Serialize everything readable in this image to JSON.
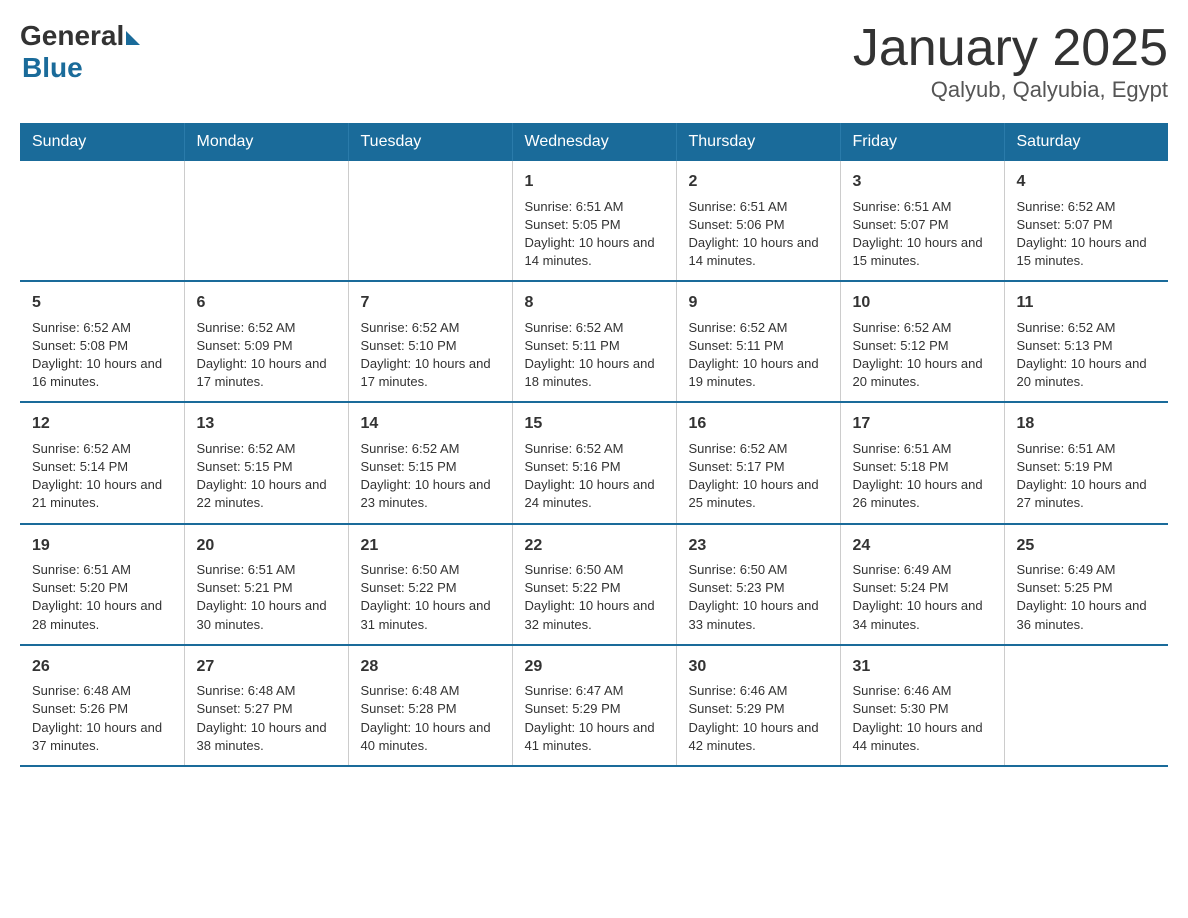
{
  "logo": {
    "general": "General",
    "blue": "Blue"
  },
  "title": "January 2025",
  "subtitle": "Qalyub, Qalyubia, Egypt",
  "days_of_week": [
    "Sunday",
    "Monday",
    "Tuesday",
    "Wednesday",
    "Thursday",
    "Friday",
    "Saturday"
  ],
  "weeks": [
    [
      {
        "day": "",
        "info": ""
      },
      {
        "day": "",
        "info": ""
      },
      {
        "day": "",
        "info": ""
      },
      {
        "day": "1",
        "info": "Sunrise: 6:51 AM\nSunset: 5:05 PM\nDaylight: 10 hours and 14 minutes."
      },
      {
        "day": "2",
        "info": "Sunrise: 6:51 AM\nSunset: 5:06 PM\nDaylight: 10 hours and 14 minutes."
      },
      {
        "day": "3",
        "info": "Sunrise: 6:51 AM\nSunset: 5:07 PM\nDaylight: 10 hours and 15 minutes."
      },
      {
        "day": "4",
        "info": "Sunrise: 6:52 AM\nSunset: 5:07 PM\nDaylight: 10 hours and 15 minutes."
      }
    ],
    [
      {
        "day": "5",
        "info": "Sunrise: 6:52 AM\nSunset: 5:08 PM\nDaylight: 10 hours and 16 minutes."
      },
      {
        "day": "6",
        "info": "Sunrise: 6:52 AM\nSunset: 5:09 PM\nDaylight: 10 hours and 17 minutes."
      },
      {
        "day": "7",
        "info": "Sunrise: 6:52 AM\nSunset: 5:10 PM\nDaylight: 10 hours and 17 minutes."
      },
      {
        "day": "8",
        "info": "Sunrise: 6:52 AM\nSunset: 5:11 PM\nDaylight: 10 hours and 18 minutes."
      },
      {
        "day": "9",
        "info": "Sunrise: 6:52 AM\nSunset: 5:11 PM\nDaylight: 10 hours and 19 minutes."
      },
      {
        "day": "10",
        "info": "Sunrise: 6:52 AM\nSunset: 5:12 PM\nDaylight: 10 hours and 20 minutes."
      },
      {
        "day": "11",
        "info": "Sunrise: 6:52 AM\nSunset: 5:13 PM\nDaylight: 10 hours and 20 minutes."
      }
    ],
    [
      {
        "day": "12",
        "info": "Sunrise: 6:52 AM\nSunset: 5:14 PM\nDaylight: 10 hours and 21 minutes."
      },
      {
        "day": "13",
        "info": "Sunrise: 6:52 AM\nSunset: 5:15 PM\nDaylight: 10 hours and 22 minutes."
      },
      {
        "day": "14",
        "info": "Sunrise: 6:52 AM\nSunset: 5:15 PM\nDaylight: 10 hours and 23 minutes."
      },
      {
        "day": "15",
        "info": "Sunrise: 6:52 AM\nSunset: 5:16 PM\nDaylight: 10 hours and 24 minutes."
      },
      {
        "day": "16",
        "info": "Sunrise: 6:52 AM\nSunset: 5:17 PM\nDaylight: 10 hours and 25 minutes."
      },
      {
        "day": "17",
        "info": "Sunrise: 6:51 AM\nSunset: 5:18 PM\nDaylight: 10 hours and 26 minutes."
      },
      {
        "day": "18",
        "info": "Sunrise: 6:51 AM\nSunset: 5:19 PM\nDaylight: 10 hours and 27 minutes."
      }
    ],
    [
      {
        "day": "19",
        "info": "Sunrise: 6:51 AM\nSunset: 5:20 PM\nDaylight: 10 hours and 28 minutes."
      },
      {
        "day": "20",
        "info": "Sunrise: 6:51 AM\nSunset: 5:21 PM\nDaylight: 10 hours and 30 minutes."
      },
      {
        "day": "21",
        "info": "Sunrise: 6:50 AM\nSunset: 5:22 PM\nDaylight: 10 hours and 31 minutes."
      },
      {
        "day": "22",
        "info": "Sunrise: 6:50 AM\nSunset: 5:22 PM\nDaylight: 10 hours and 32 minutes."
      },
      {
        "day": "23",
        "info": "Sunrise: 6:50 AM\nSunset: 5:23 PM\nDaylight: 10 hours and 33 minutes."
      },
      {
        "day": "24",
        "info": "Sunrise: 6:49 AM\nSunset: 5:24 PM\nDaylight: 10 hours and 34 minutes."
      },
      {
        "day": "25",
        "info": "Sunrise: 6:49 AM\nSunset: 5:25 PM\nDaylight: 10 hours and 36 minutes."
      }
    ],
    [
      {
        "day": "26",
        "info": "Sunrise: 6:48 AM\nSunset: 5:26 PM\nDaylight: 10 hours and 37 minutes."
      },
      {
        "day": "27",
        "info": "Sunrise: 6:48 AM\nSunset: 5:27 PM\nDaylight: 10 hours and 38 minutes."
      },
      {
        "day": "28",
        "info": "Sunrise: 6:48 AM\nSunset: 5:28 PM\nDaylight: 10 hours and 40 minutes."
      },
      {
        "day": "29",
        "info": "Sunrise: 6:47 AM\nSunset: 5:29 PM\nDaylight: 10 hours and 41 minutes."
      },
      {
        "day": "30",
        "info": "Sunrise: 6:46 AM\nSunset: 5:29 PM\nDaylight: 10 hours and 42 minutes."
      },
      {
        "day": "31",
        "info": "Sunrise: 6:46 AM\nSunset: 5:30 PM\nDaylight: 10 hours and 44 minutes."
      },
      {
        "day": "",
        "info": ""
      }
    ]
  ]
}
